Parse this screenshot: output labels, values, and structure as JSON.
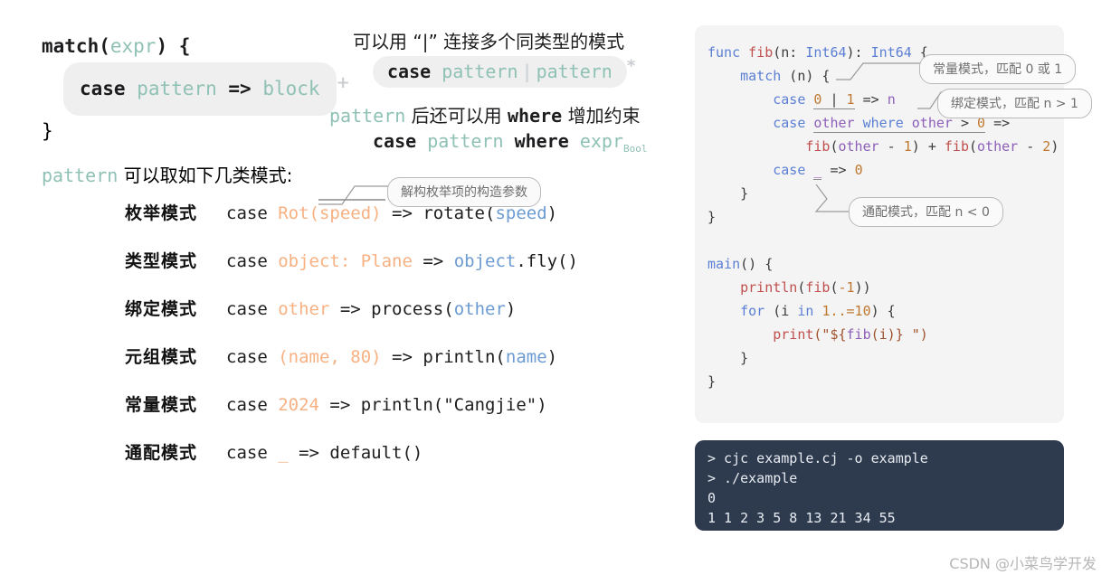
{
  "left_schematic": {
    "line1_a": "match(",
    "line1_b": "expr",
    "line1_c": ") {",
    "pill_case": "case",
    "pill_pattern": "pattern",
    "pill_arrow": "=>",
    "pill_block": "block",
    "plus_marker": "+",
    "line3": "}"
  },
  "notes": {
    "note1": "可以用 “|” 连接多个同类型的模式",
    "pill2_case": "case",
    "pill2_pattern_a": "pattern",
    "pill2_bar": "|",
    "pill2_pattern_b": "pattern",
    "star_marker": "*",
    "note2_a": "pattern",
    "note2_b": " 后还可以用 ",
    "note2_c": "where",
    "note2_d": " 增加约束",
    "note3_case": "case",
    "note3_pattern": "pattern",
    "note3_where": "where",
    "note3_expr": "expr",
    "note3_sub": "Bool"
  },
  "pattern_list": {
    "heading_token": "pattern",
    "heading_text": " 可以取如下几类模式:",
    "rows": [
      {
        "name": "枚举模式",
        "code_case": "case ",
        "code_pat": "Rot(speed)",
        "code_arrow": " => ",
        "code_body_pre": "rotate(",
        "code_body_var": "speed",
        "code_body_post": ")"
      },
      {
        "name": "类型模式",
        "code_case": "case ",
        "code_pat": "object: Plane",
        "code_arrow": " => ",
        "code_body_pre": "",
        "code_body_var": "object",
        "code_body_post": ".fly()"
      },
      {
        "name": "绑定模式",
        "code_case": "case ",
        "code_pat": "other",
        "code_arrow": " => ",
        "code_body_pre": "process(",
        "code_body_var": "other",
        "code_body_post": ")"
      },
      {
        "name": "元组模式",
        "code_case": "case ",
        "code_pat": "(name, 80)",
        "code_arrow": " => ",
        "code_body_pre": "println(",
        "code_body_var": "name",
        "code_body_post": ")"
      },
      {
        "name": "常量模式",
        "code_case": "case ",
        "code_pat": "2024",
        "code_arrow": " => ",
        "code_body_pre": "println(\"Cangjie\")",
        "code_body_var": "",
        "code_body_post": ""
      },
      {
        "name": "通配模式",
        "code_case": "case ",
        "code_pat": "_",
        "code_arrow": " => ",
        "code_body_pre": "default()",
        "code_body_var": "",
        "code_body_post": ""
      }
    ]
  },
  "callouts": {
    "enum_destructure": "解构枚举项的构造参数",
    "const_pattern": "常量模式，匹配 0 或 1",
    "binding_pattern": "绑定模式，匹配 n > 1",
    "wildcard_pattern": "通配模式，匹配 n < 0"
  },
  "code": {
    "l1_kw": "func",
    "l1_fn": "fib",
    "l1_p1": "(n: ",
    "l1_t1": "Int64",
    "l1_p2": "): ",
    "l1_t2": "Int64",
    "l1_p3": " {",
    "l2_kw": "match",
    "l2_rest": " (n) {",
    "l3_kw": "case",
    "l3_n0": "0",
    "l3_bar": " | ",
    "l3_n1": "1",
    "l3_arrow": " => ",
    "l3_var": "n",
    "l4_kw": "case",
    "l4_var": "other",
    "l4_kw2": "where",
    "l4_var2": "other",
    "l4_op": " > ",
    "l4_num": "0",
    "l4_arrow": " =>",
    "l5_fn": "fib",
    "l5_a": "(",
    "l5_var": "other",
    "l5_b": " - ",
    "l5_n": "1",
    "l5_c": ") + ",
    "l5_fn2": "fib",
    "l5_d": "(",
    "l5_var2": "other",
    "l5_e": " - ",
    "l5_n2": "2",
    "l5_f": ")",
    "l6_kw": "case",
    "l6_us": "_",
    "l6_arrow": " => ",
    "l6_num": "0",
    "l7": "}",
    "l8": "}",
    "l10_kw": "main",
    "l10_rest": "() {",
    "l11_fn": "println",
    "l11_a": "(",
    "l11_fn2": "fib",
    "l11_b": "(",
    "l11_n": "-1",
    "l11_c": "))",
    "l12_kw": "for",
    "l12_a": " (i ",
    "l12_kw2": "in",
    "l12_b": " ",
    "l12_n": "1..=10",
    "l12_c": ") {",
    "l13_fn": "print",
    "l13_a": "(\"${",
    "l13_fn2": "fib",
    "l13_b": "(i)} \")",
    "l14": "}",
    "l15": "}"
  },
  "terminal": {
    "line1": "> cjc example.cj -o example",
    "line2": "> ./example",
    "line3": "0",
    "line4": "1 1 2 3 5 8 13 21 34 55"
  },
  "watermark": "CSDN @小菜鸟学开发",
  "colors": {
    "teal_placeholder": "#8fc1b5",
    "orange_pattern": "#f7b183",
    "blue_var": "#6c9bd2",
    "code_keyword": "#5b7fd4",
    "code_function": "#c0504d",
    "code_variable": "#8d5fb8",
    "code_number": "#c07830",
    "terminal_bg": "#2e3b4e",
    "card_bg": "#f4f4f4"
  }
}
